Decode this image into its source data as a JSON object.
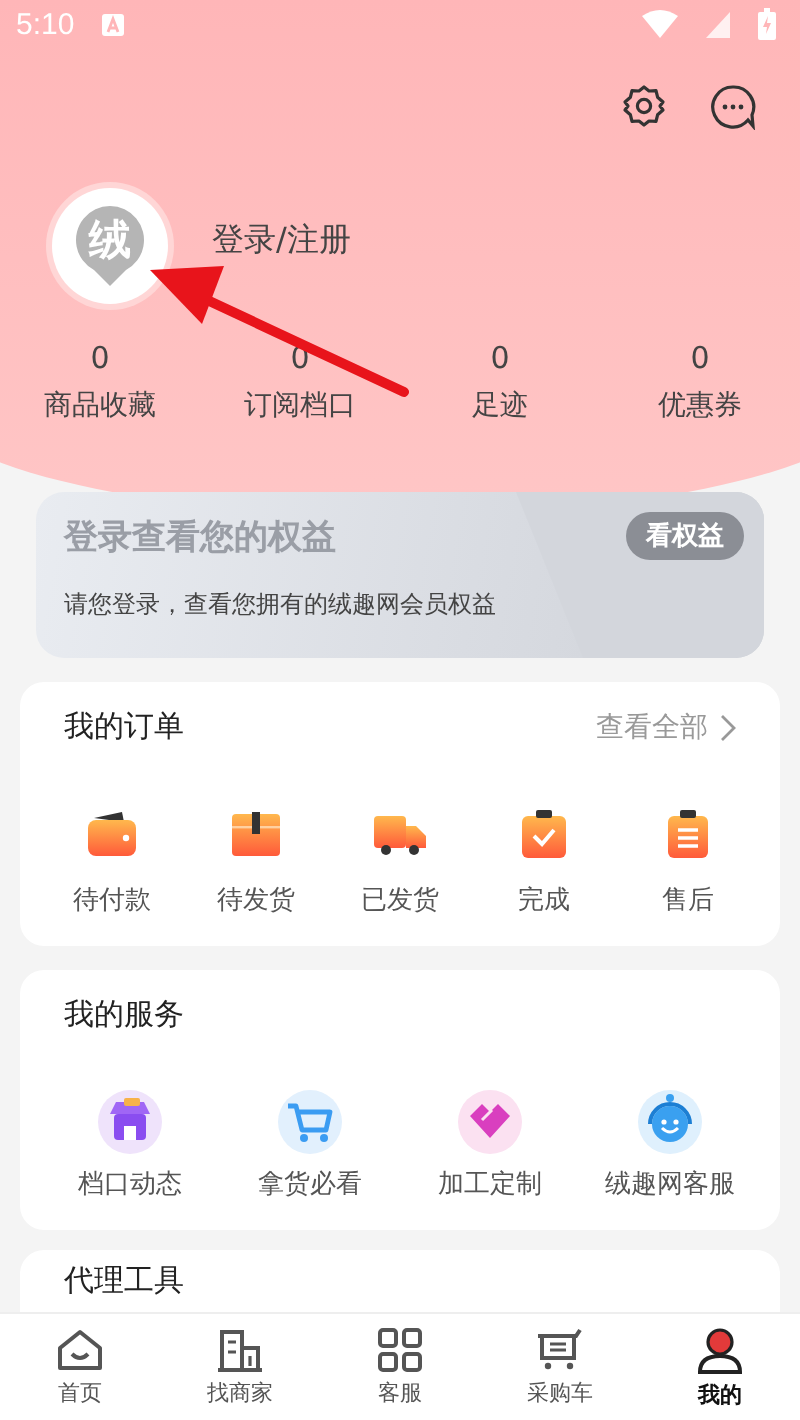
{
  "status_bar": {
    "time": "5:10"
  },
  "profile": {
    "logo": "绒",
    "login": "登录/注册",
    "stats": [
      {
        "value": "0",
        "label": "商品收藏"
      },
      {
        "value": "0",
        "label": "订阅档口"
      },
      {
        "value": "0",
        "label": "足迹"
      },
      {
        "value": "0",
        "label": "优惠券"
      }
    ]
  },
  "benefits": {
    "title": "登录查看您的权益",
    "button": "看权益",
    "text": "请您登录，查看您拥有的绒趣网会员权益"
  },
  "orders": {
    "title": "我的订单",
    "link": "查看全部",
    "items": [
      "待付款",
      "待发货",
      "已发货",
      "完成",
      "售后"
    ]
  },
  "services": {
    "title": "我的服务",
    "items": [
      "档口动态",
      "拿货必看",
      "加工定制",
      "绒趣网客服"
    ]
  },
  "agent_tools": {
    "title": "代理工具"
  },
  "tab_bar": [
    {
      "label": "首页",
      "selected": false
    },
    {
      "label": "找商家",
      "selected": false
    },
    {
      "label": "客服",
      "selected": false
    },
    {
      "label": "采购车",
      "selected": false
    },
    {
      "label": "我的",
      "selected": true
    }
  ]
}
